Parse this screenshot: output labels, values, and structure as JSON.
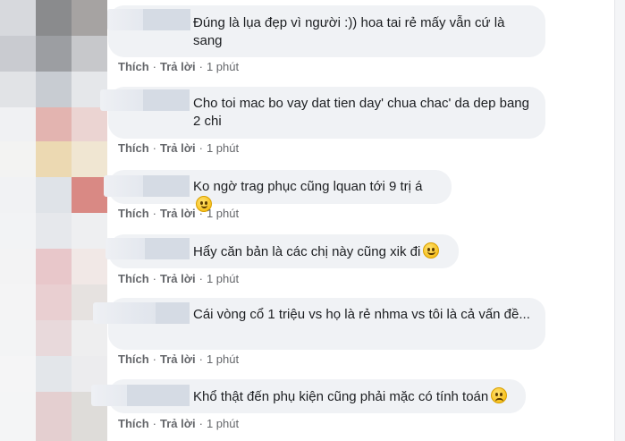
{
  "comments": [
    {
      "text": "Đúng là lụa đẹp vì người :)) hoa tai rẻ mấy vẫn cứ là sang",
      "emoji": "",
      "like": "Thích",
      "reply": "Trả lời",
      "time": "1 phút"
    },
    {
      "text": "Cho toi mac bo vay dat tien day' chua chac' da dep bang 2 chi",
      "emoji": "",
      "like": "Thích",
      "reply": "Trả lời",
      "time": "1 phút"
    },
    {
      "text": "Ko ngờ trag phục cũng lquan tới 9 trị á",
      "emoji": "nerd-face-emoji",
      "like": "Thích",
      "reply": "Trả lời",
      "time": "1 phút"
    },
    {
      "text": "Hẩy căn bản là các chị này cũng xik đi",
      "emoji": "smiling-face-emoji",
      "like": "Thích",
      "reply": "Trả lời",
      "time": "1 phút"
    },
    {
      "text": "Cái vòng cổ 1 triệu vs họ là rẻ nhma vs tôi là cả vấn đề...",
      "emoji": "",
      "like": "Thích",
      "reply": "Trả lời",
      "time": "1 phút"
    },
    {
      "text": "Khổ thật đến phụ kiện cũng phải mặc có tính toán",
      "emoji": "sad-face-emoji",
      "like": "Thích",
      "reply": "Trả lời",
      "time": "1 phút"
    }
  ],
  "colors": {
    "bubble": "#f0f2f5",
    "text": "#1c1e21",
    "meta": "#65676b"
  }
}
